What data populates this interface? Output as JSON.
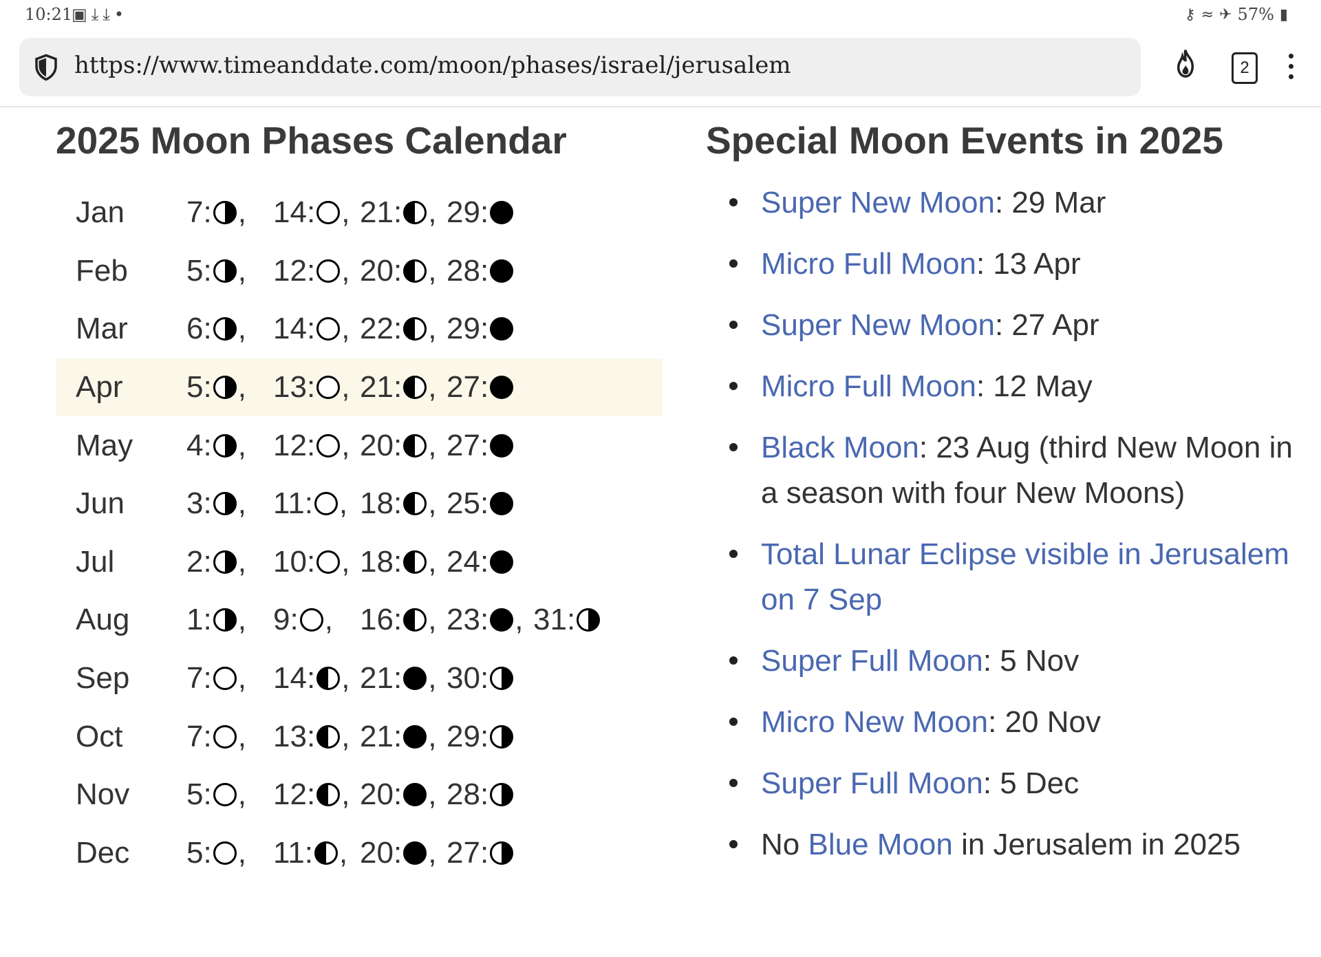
{
  "status_bar": {
    "time": "10:21",
    "left_icons": [
      "image-icon",
      "download-icon",
      "download-icon",
      "dot-icon"
    ],
    "battery": "57%",
    "right_icons": [
      "key-icon",
      "wifi-icon",
      "airplane-icon",
      "battery-icon"
    ]
  },
  "browser": {
    "url": "https://www.timeanddate.com/moon/phases/israel/jerusalem",
    "tab_count": "2"
  },
  "calendar": {
    "title": "2025 Moon Phases Calendar",
    "highlighted_month": "Apr",
    "rows": [
      {
        "month": "Jan",
        "phases": [
          {
            "day": "7",
            "phase": "first"
          },
          {
            "day": "14",
            "phase": "full"
          },
          {
            "day": "21",
            "phase": "third"
          },
          {
            "day": "29",
            "phase": "new"
          }
        ]
      },
      {
        "month": "Feb",
        "phases": [
          {
            "day": "5",
            "phase": "first"
          },
          {
            "day": "12",
            "phase": "full"
          },
          {
            "day": "20",
            "phase": "third"
          },
          {
            "day": "28",
            "phase": "new"
          }
        ]
      },
      {
        "month": "Mar",
        "phases": [
          {
            "day": "6",
            "phase": "first"
          },
          {
            "day": "14",
            "phase": "full"
          },
          {
            "day": "22",
            "phase": "third"
          },
          {
            "day": "29",
            "phase": "new"
          }
        ]
      },
      {
        "month": "Apr",
        "phases": [
          {
            "day": "5",
            "phase": "first"
          },
          {
            "day": "13",
            "phase": "full"
          },
          {
            "day": "21",
            "phase": "third"
          },
          {
            "day": "27",
            "phase": "new"
          }
        ]
      },
      {
        "month": "May",
        "phases": [
          {
            "day": "4",
            "phase": "first"
          },
          {
            "day": "12",
            "phase": "full"
          },
          {
            "day": "20",
            "phase": "third"
          },
          {
            "day": "27",
            "phase": "new"
          }
        ]
      },
      {
        "month": "Jun",
        "phases": [
          {
            "day": "3",
            "phase": "first"
          },
          {
            "day": "11",
            "phase": "full"
          },
          {
            "day": "18",
            "phase": "third"
          },
          {
            "day": "25",
            "phase": "new"
          }
        ]
      },
      {
        "month": "Jul",
        "phases": [
          {
            "day": "2",
            "phase": "first"
          },
          {
            "day": "10",
            "phase": "full"
          },
          {
            "day": "18",
            "phase": "third"
          },
          {
            "day": "24",
            "phase": "new"
          }
        ]
      },
      {
        "month": "Aug",
        "phases": [
          {
            "day": "1",
            "phase": "first"
          },
          {
            "day": "9",
            "phase": "full"
          },
          {
            "day": "16",
            "phase": "third"
          },
          {
            "day": "23",
            "phase": "new"
          },
          {
            "day": "31",
            "phase": "first"
          }
        ]
      },
      {
        "month": "Sep",
        "phases": [
          {
            "day": "7",
            "phase": "full"
          },
          {
            "day": "14",
            "phase": "third"
          },
          {
            "day": "21",
            "phase": "new"
          },
          {
            "day": "30",
            "phase": "first"
          }
        ]
      },
      {
        "month": "Oct",
        "phases": [
          {
            "day": "7",
            "phase": "full"
          },
          {
            "day": "13",
            "phase": "third"
          },
          {
            "day": "21",
            "phase": "new"
          },
          {
            "day": "29",
            "phase": "first"
          }
        ]
      },
      {
        "month": "Nov",
        "phases": [
          {
            "day": "5",
            "phase": "full"
          },
          {
            "day": "12",
            "phase": "third"
          },
          {
            "day": "20",
            "phase": "new"
          },
          {
            "day": "28",
            "phase": "first"
          }
        ]
      },
      {
        "month": "Dec",
        "phases": [
          {
            "day": "5",
            "phase": "full"
          },
          {
            "day": "11",
            "phase": "third"
          },
          {
            "day": "20",
            "phase": "new"
          },
          {
            "day": "27",
            "phase": "first"
          }
        ]
      }
    ]
  },
  "events": {
    "title": "Special Moon Events in 2025",
    "items": [
      {
        "prefix": "",
        "link": "Super New Moon",
        "suffix": ": 29 Mar"
      },
      {
        "prefix": "",
        "link": "Micro Full Moon",
        "suffix": ": 13 Apr"
      },
      {
        "prefix": "",
        "link": "Super New Moon",
        "suffix": ": 27 Apr"
      },
      {
        "prefix": "",
        "link": "Micro Full Moon",
        "suffix": ": 12 May"
      },
      {
        "prefix": "",
        "link": "Black Moon",
        "suffix": ": 23 Aug (third New Moon in a season with four New Moons)"
      },
      {
        "prefix": "",
        "link": "Total Lunar Eclipse visible in Jerusalem on 7 Sep",
        "suffix": ""
      },
      {
        "prefix": "",
        "link": "Super Full Moon",
        "suffix": ": 5 Nov"
      },
      {
        "prefix": "",
        "link": "Micro New Moon",
        "suffix": ": 20 Nov"
      },
      {
        "prefix": "",
        "link": "Super Full Moon",
        "suffix": ": 5 Dec"
      },
      {
        "prefix": "No ",
        "link": "Blue Moon",
        "suffix": " in Jerusalem in 2025"
      }
    ]
  },
  "colors": {
    "link": "#4a68b1",
    "highlight_row": "#fbf8ea",
    "url_bar": "#efefef"
  }
}
